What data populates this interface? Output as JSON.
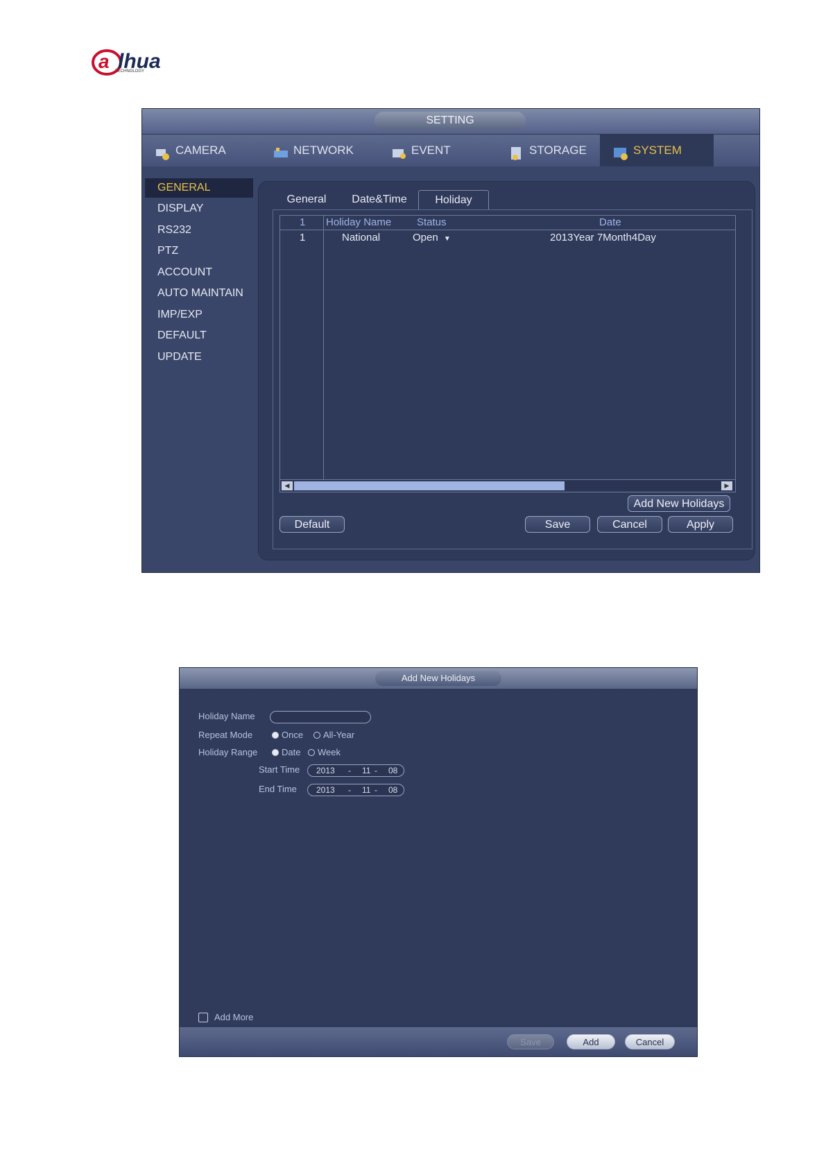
{
  "logo": {
    "brand_text": "alhua",
    "sub_text": "TECHNOLOGY"
  },
  "setting": {
    "title": "SETTING",
    "tabs": [
      "CAMERA",
      "NETWORK",
      "EVENT",
      "STORAGE",
      "SYSTEM"
    ],
    "active_tab": "SYSTEM",
    "sidebar": [
      "GENERAL",
      "DISPLAY",
      "RS232",
      "PTZ",
      "ACCOUNT",
      "AUTO MAINTAIN",
      "IMP/EXP",
      "DEFAULT",
      "UPDATE"
    ],
    "active_sidebar": "GENERAL",
    "inner_tabs": [
      "General",
      "Date&Time",
      "Holiday"
    ],
    "active_inner_tab": "Holiday",
    "table": {
      "headers": {
        "index": "1",
        "name": "Holiday Name",
        "status": "Status",
        "date": "Date"
      },
      "rows": [
        {
          "index": "1",
          "name": "National",
          "status": "Open",
          "date": "2013Year 7Month4Day"
        }
      ]
    },
    "buttons": {
      "add_new_holidays": "Add New Holidays",
      "default": "Default",
      "save": "Save",
      "cancel": "Cancel",
      "apply": "Apply"
    },
    "colors": {
      "accent": "#e9c14a",
      "panel": "#3a4669",
      "header_text": "#9fb3e6"
    }
  },
  "dialog": {
    "title": "Add New Holidays",
    "labels": {
      "holiday_name": "Holiday Name",
      "repeat_mode": "Repeat Mode",
      "holiday_range": "Holiday Range",
      "start_time": "Start Time",
      "end_time": "End Time"
    },
    "holiday_name_value": "",
    "repeat_mode": {
      "options": [
        "Once",
        "All-Year"
      ],
      "selected": "Once"
    },
    "holiday_range": {
      "options": [
        "Date",
        "Week"
      ],
      "selected": "Date"
    },
    "start_time": {
      "year": "2013",
      "sep": "-",
      "month": "11",
      "sep2": "-",
      "day": "08"
    },
    "end_time": {
      "year": "2013",
      "sep": "-",
      "month": "11",
      "sep2": "-",
      "day": "08"
    },
    "add_more": "Add More",
    "buttons": {
      "save": "Save",
      "add": "Add",
      "cancel": "Cancel"
    }
  }
}
